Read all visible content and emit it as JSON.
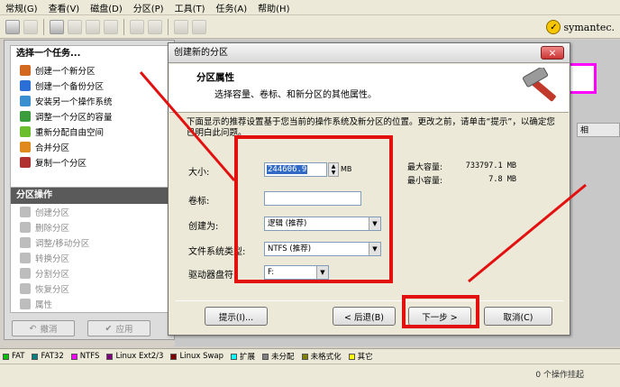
{
  "menu": [
    "常规(G)",
    "查看(V)",
    "磁盘(D)",
    "分区(P)",
    "工具(T)",
    "任务(A)",
    "帮助(H)"
  ],
  "brand": "symantec.",
  "left": {
    "tasks_header": "选择一个任务...",
    "tasks": [
      {
        "label": "创建一个新分区",
        "color": "#d2691e"
      },
      {
        "label": "创建一个备份分区",
        "color": "#2a6fd6"
      },
      {
        "label": "安装另一个操作系统",
        "color": "#3a8fd0"
      },
      {
        "label": "调整一个分区的容量",
        "color": "#3a9c3a"
      },
      {
        "label": "重新分配自由空间",
        "color": "#6bbf2f"
      },
      {
        "label": "合并分区",
        "color": "#e08a1e"
      },
      {
        "label": "复制一个分区",
        "color": "#b03030"
      }
    ],
    "ops_header": "分区操作",
    "ops": [
      "创建分区",
      "删除分区",
      "调整/移动分区",
      "转换分区",
      "分割分区",
      "恢复分区",
      "属性"
    ],
    "undo_label": "撤消",
    "apply_label": "应用"
  },
  "bg_strip": "相",
  "dialog": {
    "title": "创建新的分区",
    "close": "×",
    "header_title": "分区属性",
    "header_sub": "选择容量、卷标、和新分区的其他属性。",
    "desc": "下面显示的推荐设置基于您当前的操作系统及新分区的位置。更改之前，请单击“提示”，以确定您已明白此问题。",
    "size_label": "大小:",
    "size_value": "244606.9",
    "size_unit": "MB",
    "label_label": "卷标:",
    "label_value": "",
    "create_as_label": "创建为:",
    "create_as_value": "逻辑 (推荐)",
    "fs_label": "文件系统类型:",
    "fs_value": "NTFS (推荐)",
    "drive_label": "驱动器盘符:",
    "drive_value": "F:",
    "max_label": "最大容量:",
    "max_value": "733797.1 MB",
    "min_label": "最小容量:",
    "min_value": "7.8 MB",
    "hint_btn": "提示(I)...",
    "back_btn": "< 后退(B)",
    "next_btn": "下一步 >",
    "cancel_btn": "取消(C)"
  },
  "legend": [
    {
      "label": "FAT",
      "color": "#00c000"
    },
    {
      "label": "FAT32",
      "color": "#008080"
    },
    {
      "label": "NTFS",
      "color": "#ff00ff"
    },
    {
      "label": "Linux Ext2/3",
      "color": "#800080"
    },
    {
      "label": "Linux Swap",
      "color": "#800000"
    },
    {
      "label": "扩展",
      "color": "#00ffff"
    },
    {
      "label": "未分配",
      "color": "#808080"
    },
    {
      "label": "未格式化",
      "color": "#808000"
    },
    {
      "label": "其它",
      "color": "#ffff00"
    }
  ],
  "status_text": "0 个操作挂起"
}
